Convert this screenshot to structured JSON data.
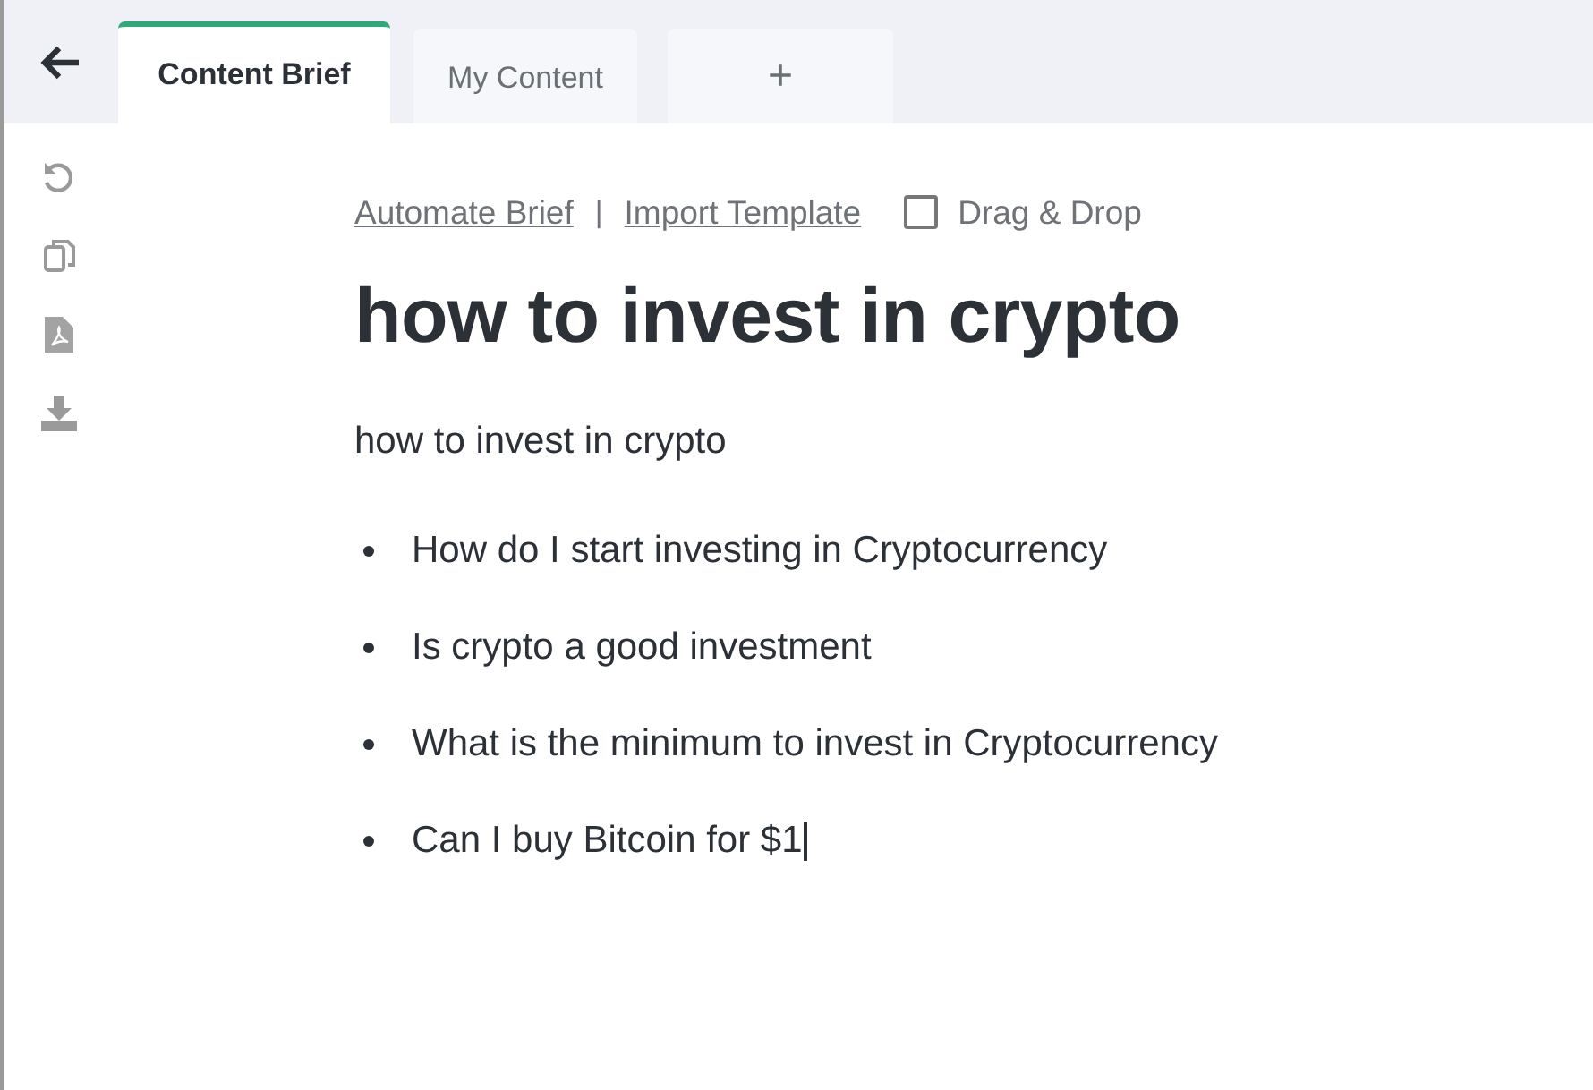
{
  "tabs": [
    {
      "label": "Content Brief",
      "selected": true
    },
    {
      "label": "My Content",
      "selected": false
    }
  ],
  "add_tab": "+",
  "actions": {
    "links": [
      "Automate Brief",
      "Import Template"
    ],
    "separator": "|",
    "checkbox": {
      "label": "Drag & Drop",
      "checked": false
    }
  },
  "document": {
    "title": "how to invest in crypto",
    "intro": "how to invest in crypto",
    "bullets": [
      "How do I start investing in Cryptocurrency",
      "Is crypto a good investment",
      "What is the minimum to invest in Cryptocurrency",
      "Can I buy Bitcoin for $1"
    ]
  }
}
